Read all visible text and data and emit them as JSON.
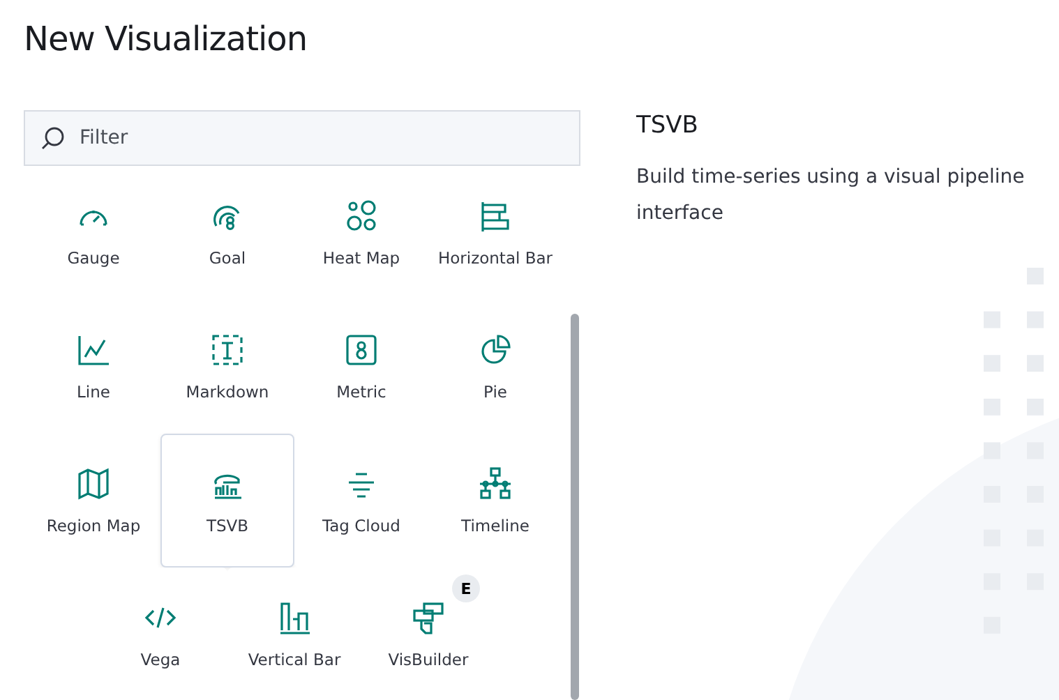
{
  "title": "New Visualization",
  "search": {
    "placeholder": "Filter"
  },
  "items": [
    {
      "kind": "gauge",
      "label": "Gauge",
      "selected": false
    },
    {
      "kind": "goal",
      "label": "Goal",
      "selected": false
    },
    {
      "kind": "heatmap",
      "label": "Heat Map",
      "selected": false
    },
    {
      "kind": "hbar",
      "label": "Horizontal Bar",
      "selected": false
    },
    {
      "kind": "line",
      "label": "Line",
      "selected": false
    },
    {
      "kind": "markdown",
      "label": "Markdown",
      "selected": false
    },
    {
      "kind": "metric",
      "label": "Metric",
      "selected": false
    },
    {
      "kind": "pie",
      "label": "Pie",
      "selected": false
    },
    {
      "kind": "region",
      "label": "Region Map",
      "selected": false
    },
    {
      "kind": "tsvb",
      "label": "TSVB",
      "selected": true
    },
    {
      "kind": "tagcloud",
      "label": "Tag Cloud",
      "selected": false
    },
    {
      "kind": "timeline",
      "label": "Timeline",
      "selected": false
    },
    {
      "kind": "vega",
      "label": "Vega",
      "selected": false
    },
    {
      "kind": "vbar",
      "label": "Vertical Bar",
      "selected": false
    },
    {
      "kind": "visbuilder",
      "label": "VisBuilder",
      "selected": false,
      "badge": "E"
    }
  ],
  "detail": {
    "title": "TSVB",
    "description": "Build time-series using a visual pipeline interface"
  }
}
